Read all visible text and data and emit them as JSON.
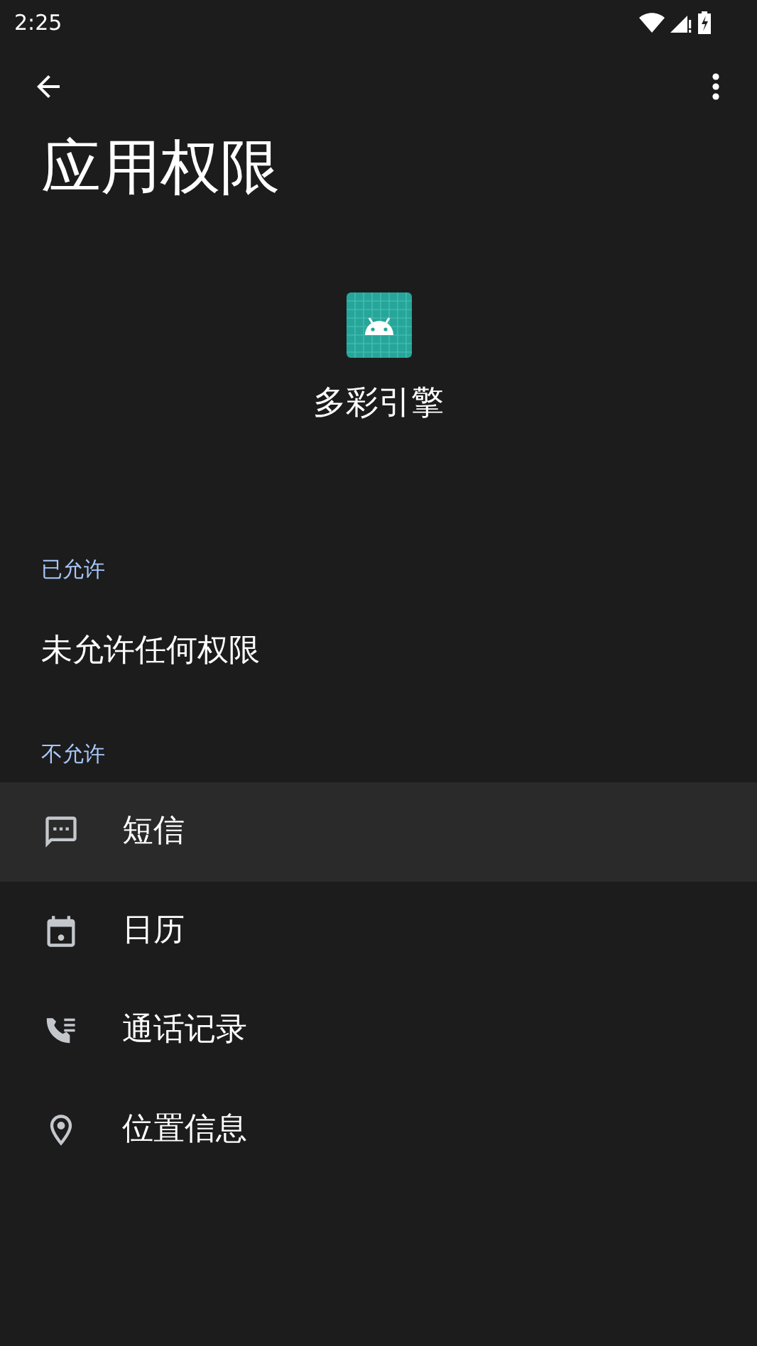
{
  "status_bar": {
    "time": "2:25"
  },
  "title": "应用权限",
  "app": {
    "name": "多彩引擎"
  },
  "allowed": {
    "header": "已允许",
    "empty_text": "未允许任何权限"
  },
  "denied": {
    "header": "不允许",
    "items": [
      {
        "label": "短信",
        "kind": "sms",
        "selected": true
      },
      {
        "label": "日历",
        "kind": "calendar",
        "selected": false
      },
      {
        "label": "通话记录",
        "kind": "call_log",
        "selected": false
      },
      {
        "label": "位置信息",
        "kind": "location",
        "selected": false
      }
    ]
  }
}
